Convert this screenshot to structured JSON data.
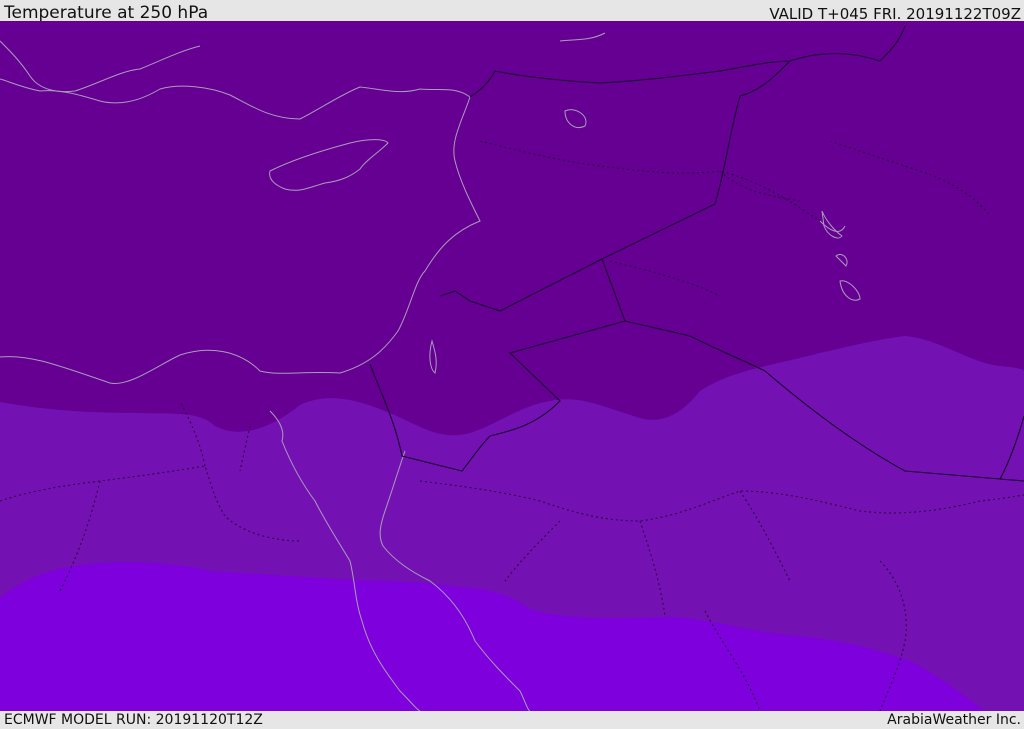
{
  "header": {
    "title": "Temperature at 250 hPa",
    "valid": "VALID T+045 FRI. 20191122T09Z"
  },
  "footer": {
    "model_run": "ECMWF MODEL RUN: 20191120T12Z",
    "credit": "ArabiaWeather Inc."
  },
  "colors": {
    "band_coldest": "#650093",
    "band_cold": "#7411b3",
    "band_cool": "#7d00dd",
    "panel": "#e6e6e6",
    "coastline": "#a99dba",
    "borders": "#2a0540"
  }
}
